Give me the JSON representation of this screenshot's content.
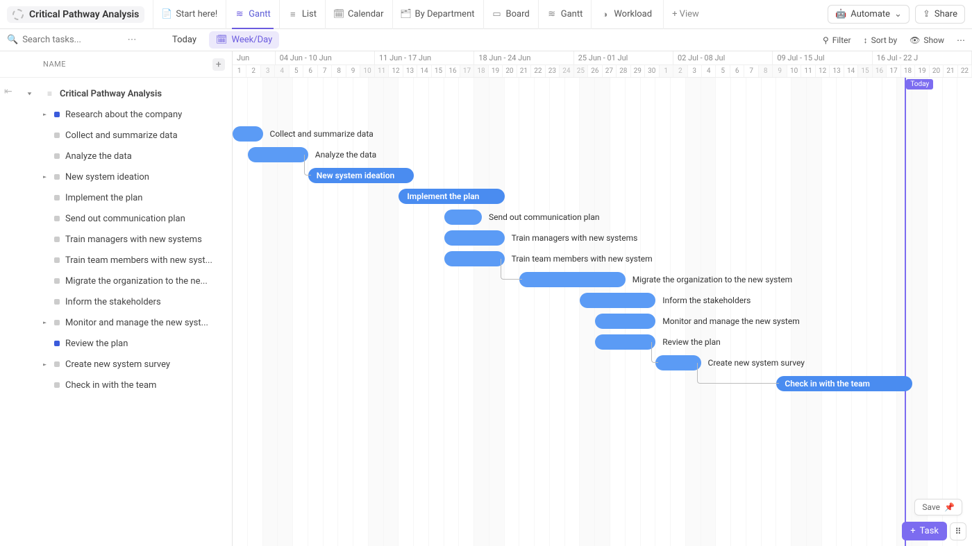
{
  "header": {
    "title": "Critical Pathway Analysis",
    "views": [
      {
        "id": "start",
        "label": "Start here!",
        "icon": "📄",
        "active": false
      },
      {
        "id": "gantt",
        "label": "Gantt",
        "icon": "≋",
        "active": true
      },
      {
        "id": "list",
        "label": "List",
        "icon": "≡",
        "active": false
      },
      {
        "id": "calendar",
        "label": "Calendar",
        "icon": "🗓",
        "active": false
      },
      {
        "id": "bydept",
        "label": "By Department",
        "icon": "🗂",
        "active": false
      },
      {
        "id": "board",
        "label": "Board",
        "icon": "▭",
        "active": false
      },
      {
        "id": "gantt2",
        "label": "Gantt",
        "icon": "≋",
        "active": false
      },
      {
        "id": "workload",
        "label": "Workload",
        "icon": "◑",
        "active": false
      }
    ],
    "add_view": "+ View",
    "automate": "Automate",
    "share": "Share"
  },
  "toolbar": {
    "search_placeholder": "Search tasks...",
    "today": "Today",
    "zoom": "Week/Day",
    "filter": "Filter",
    "sortby": "Sort by",
    "show": "Show"
  },
  "left": {
    "name_header": "NAME",
    "root": "Critical Pathway Analysis",
    "tasks": [
      {
        "name": "Research about the company",
        "color": "blue",
        "expandable": true
      },
      {
        "name": "Collect and summarize data",
        "color": "grey"
      },
      {
        "name": "Analyze the data",
        "color": "grey"
      },
      {
        "name": "New system ideation",
        "color": "grey",
        "expandable": true
      },
      {
        "name": "Implement the plan",
        "color": "grey"
      },
      {
        "name": "Send out communication plan",
        "color": "grey"
      },
      {
        "name": "Train managers with new systems",
        "color": "grey"
      },
      {
        "name": "Train team members with new syst...",
        "color": "grey"
      },
      {
        "name": "Migrate the organization to the ne...",
        "color": "grey"
      },
      {
        "name": "Inform the stakeholders",
        "color": "grey"
      },
      {
        "name": "Monitor and manage the new syst...",
        "color": "grey",
        "expandable": true
      },
      {
        "name": "Review the plan",
        "color": "blue"
      },
      {
        "name": "Create new system survey",
        "color": "grey",
        "expandable": true
      },
      {
        "name": "Check in with the team",
        "color": "grey"
      }
    ]
  },
  "timeline": {
    "weeks": [
      {
        "label": "Jun",
        "days": 3
      },
      {
        "label": "04 Jun - 10 Jun",
        "days": 7
      },
      {
        "label": "11 Jun - 17 Jun",
        "days": 7
      },
      {
        "label": "18 Jun - 24 Jun",
        "days": 7
      },
      {
        "label": "25 Jun - 01 Jul",
        "days": 7
      },
      {
        "label": "02 Jul - 08 Jul",
        "days": 7
      },
      {
        "label": "09 Jul - 15 Jul",
        "days": 7
      },
      {
        "label": "16 Jul - 22 J",
        "days": 7
      }
    ],
    "start_day_num": 1,
    "weekend_offsets": [
      2,
      3,
      9,
      10,
      16,
      17,
      23,
      24,
      30,
      31,
      37,
      38,
      44,
      45
    ],
    "today_index": 44.5,
    "today_label": "Today"
  },
  "bars": [
    {
      "row": 1,
      "start": 0,
      "len": 2,
      "label": "Collect and summarize data",
      "filled": false
    },
    {
      "row": 2,
      "start": 1,
      "len": 4,
      "label": "Analyze the data",
      "filled": false
    },
    {
      "row": 3,
      "start": 5,
      "len": 7,
      "label": "New system ideation",
      "filled": true
    },
    {
      "row": 4,
      "start": 11,
      "len": 7,
      "label": "Implement the plan",
      "filled": true
    },
    {
      "row": 5,
      "start": 14,
      "len": 2.5,
      "label": "Send out communication plan",
      "filled": false
    },
    {
      "row": 6,
      "start": 14,
      "len": 4,
      "label": "Train managers with new systems",
      "filled": false
    },
    {
      "row": 7,
      "start": 14,
      "len": 4,
      "label": "Train team members with new system",
      "filled": false
    },
    {
      "row": 8,
      "start": 19,
      "len": 7,
      "label": "Migrate the organization to the new system",
      "filled": false
    },
    {
      "row": 9,
      "start": 23,
      "len": 5,
      "label": "Inform the stakeholders",
      "filled": false
    },
    {
      "row": 10,
      "start": 24,
      "len": 4,
      "label": "Monitor and manage the new system",
      "filled": false
    },
    {
      "row": 11,
      "start": 24,
      "len": 4,
      "label": "Review the plan",
      "filled": false
    },
    {
      "row": 12,
      "start": 28,
      "len": 3,
      "label": "Create new system survey",
      "filled": false
    },
    {
      "row": 13,
      "start": 36,
      "len": 9,
      "label": "Check in with the team",
      "filled": true
    }
  ],
  "floaters": {
    "save": "Save",
    "task": "Task"
  }
}
